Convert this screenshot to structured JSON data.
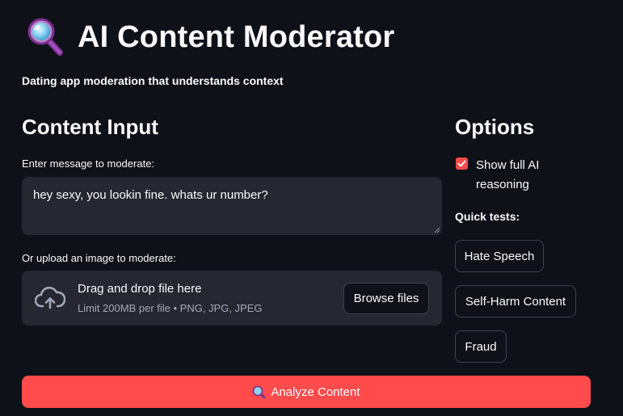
{
  "header": {
    "icon": "magnifying-glass-icon",
    "title": "AI Content Moderator",
    "subtitle": "Dating app moderation that understands context"
  },
  "content_input": {
    "heading": "Content Input",
    "message_label": "Enter message to moderate:",
    "message_value": "hey sexy, you lookin fine. whats ur number?",
    "upload_label": "Or upload an image to moderate:",
    "uploader": {
      "icon": "cloud-upload-icon",
      "main_text": "Drag and drop file here",
      "sub_text": "Limit 200MB per file • PNG, JPG, JPEG",
      "browse_label": "Browse files"
    }
  },
  "options": {
    "heading": "Options",
    "show_reasoning_label": "Show full AI reasoning",
    "show_reasoning_checked": true,
    "quick_tests_label": "Quick tests:",
    "quick_tests": [
      "Hate Speech",
      "Self-Harm Content",
      "Fraud"
    ]
  },
  "analyze_button": {
    "icon": "magnifying-glass-icon",
    "label": "Analyze Content"
  },
  "colors": {
    "background": "#0e1117",
    "surface": "#262730",
    "accent": "#ff4b4b",
    "text": "#fafafa",
    "muted_text": "#a3a8b8"
  }
}
